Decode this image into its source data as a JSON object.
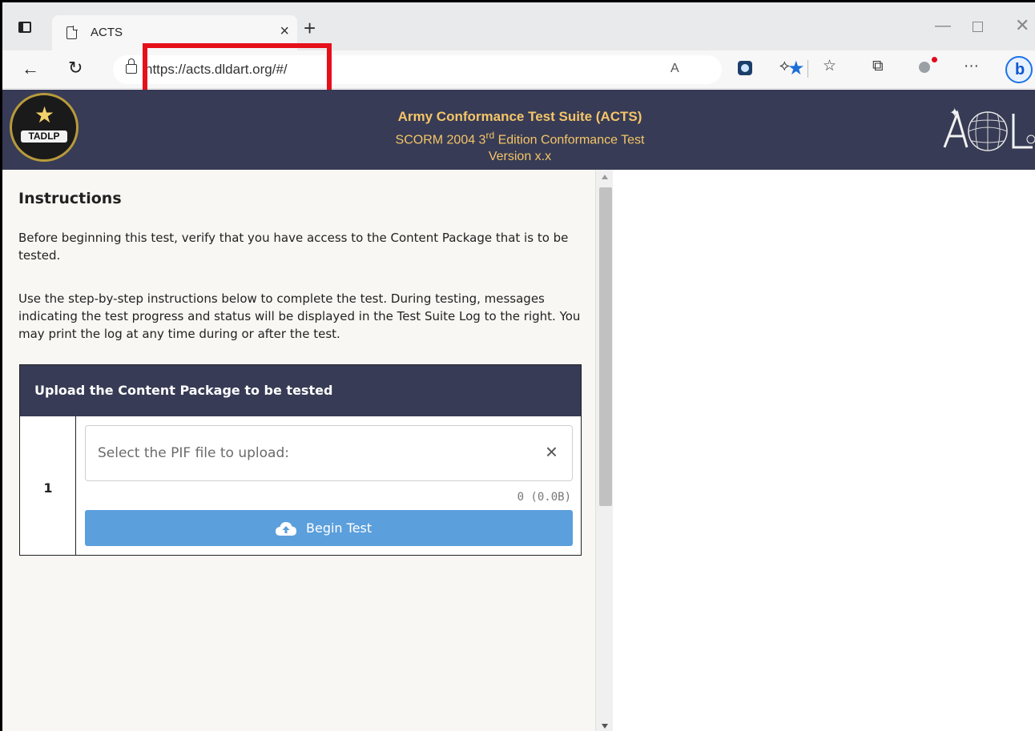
{
  "browser": {
    "tab_title": "ACTS",
    "tab_close": "×",
    "new_tab": "+",
    "url": "https://acts.dldart.org/#/",
    "read_aloud": "A",
    "toolbar_more": "···"
  },
  "header": {
    "title": "Army Conformance Test Suite (ACTS)",
    "subtitle_pre": "SCORM 2004 3",
    "subtitle_sup": "rd",
    "subtitle_post": " Edition Conformance Test",
    "version": "Version x.x",
    "logo_left_text": "TADLP"
  },
  "instructions": {
    "heading": "Instructions",
    "para1": "Before beginning this test, verify that you have access to the Content Package that is to be tested.",
    "para2": "Use the step-by-step instructions below to complete the test. During testing, messages indicating the test progress and status will be displayed in the Test Suite Log to the right. You may print the log at any time during or after the test."
  },
  "upload": {
    "header": "Upload the Content Package to be tested",
    "step_number": "1",
    "placeholder": "Select the PIF file to upload:",
    "clear": "×",
    "file_size": "0 (0.0B)",
    "button_label": "Begin Test"
  },
  "colors": {
    "header_bg": "#373b55",
    "header_text": "#f5c568",
    "button_bg": "#5b9fdc",
    "highlight": "#e5101a"
  }
}
